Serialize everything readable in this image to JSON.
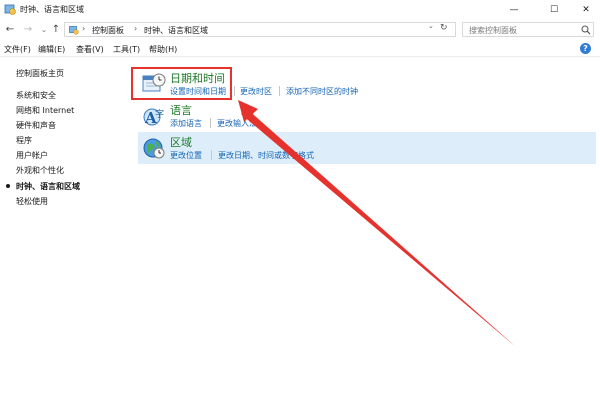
{
  "window": {
    "title": "时钟、语言和区域",
    "controls": {
      "minimize": "—",
      "maximize": "☐",
      "close": "✕"
    }
  },
  "nav": {
    "back": "←",
    "forward": "→",
    "history": "⌄",
    "up": "↑",
    "breadcrumb": [
      "控制面板",
      "时钟、语言和区域"
    ],
    "separator": "›",
    "refresh": "↻",
    "dropdown": "⌄",
    "search_placeholder": "搜索控制面板"
  },
  "menu": [
    "文件(F)",
    "编辑(E)",
    "查看(V)",
    "工具(T)",
    "帮助(H)"
  ],
  "help": "?",
  "sidebar": {
    "home": "控制面板主页",
    "items": [
      "系统和安全",
      "网络和 Internet",
      "硬件和声音",
      "程序",
      "用户帐户",
      "外观和个性化",
      "时钟、语言和区域",
      "轻松使用"
    ],
    "current_index": 6
  },
  "categories": [
    {
      "title": "日期和时间",
      "links": [
        "设置时间和日期",
        "更改时区",
        "添加不同时区的时钟"
      ]
    },
    {
      "title": "语言",
      "links": [
        "添加语言",
        "更改输入法"
      ]
    },
    {
      "title": "区域",
      "links": [
        "更改位置",
        "更改日期、时间或数字格式"
      ]
    }
  ],
  "colors": {
    "category_title": "#1a7a26",
    "link": "#1464b4",
    "highlight": "#e5322d",
    "selected_row": "#ddeefa"
  },
  "icons": {
    "app": "control-panel-icon",
    "date_time": "calendar-clock-icon",
    "language": "language-icon",
    "region": "globe-clock-icon"
  }
}
